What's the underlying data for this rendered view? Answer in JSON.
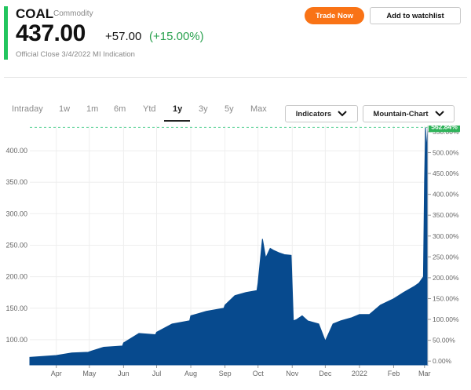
{
  "header": {
    "symbol": "COAL",
    "asset_type": "Commodity",
    "price": "437.00",
    "change": "+57.00",
    "change_pct": "(+15.00%)",
    "close_info": "Official Close 3/4/2022  MI Indication"
  },
  "actions": {
    "trade_label": "Trade Now",
    "watchlist_label": "Add to watchlist"
  },
  "timeframes": {
    "active": "1y",
    "items": [
      "Intraday",
      "1w",
      "1m",
      "6m",
      "Ytd",
      "1y",
      "3y",
      "5y",
      "Max"
    ]
  },
  "dropdowns": {
    "indicators_label": "Indicators",
    "chart_type_label": "Mountain-Chart",
    "chevron_icon": "chevron-down-icon"
  },
  "colors": {
    "accent_green": "#22c55e",
    "change_green": "#2aa14f",
    "trade_orange": "#f97316",
    "fill_blue": "#074a8e",
    "dashed_green": "#5fd39a",
    "badge_green": "#2fb35a"
  },
  "chart_data": {
    "type": "area",
    "title": "",
    "badge": "562.84%",
    "y_left_ticks": [
      "100.00",
      "150.00",
      "200.00",
      "250.00",
      "300.00",
      "350.00",
      "400.00"
    ],
    "y_right_ticks": [
      "0.00%",
      "50.00%",
      "100.00%",
      "150.00%",
      "200.00%",
      "250.00%",
      "300.00%",
      "350.00%",
      "400.00%",
      "450.00%",
      "500.00%",
      "550.00%"
    ],
    "x_labels": [
      "Apr",
      "May",
      "Jun",
      "Jul",
      "Aug",
      "Sep",
      "Oct",
      "Nov",
      "Dec",
      "2022",
      "Feb",
      "Mar"
    ],
    "ylim": [
      60,
      440
    ],
    "reference_value": 437,
    "series": [
      {
        "x": [
          "2021-03-08",
          "2021-04-01",
          "2021-04-15",
          "2021-04-30",
          "2021-05-03",
          "2021-05-14",
          "2021-05-31",
          "2021-06-01",
          "2021-06-15",
          "2021-06-30",
          "2021-07-01",
          "2021-07-15",
          "2021-07-31",
          "2021-08-01",
          "2021-08-15",
          "2021-08-31",
          "2021-09-01",
          "2021-09-10",
          "2021-09-20",
          "2021-09-30",
          "2021-10-01",
          "2021-10-05",
          "2021-10-08",
          "2021-10-12",
          "2021-10-15",
          "2021-10-20",
          "2021-10-25",
          "2021-10-31",
          "2021-11-02",
          "2021-11-05",
          "2021-11-10",
          "2021-11-15",
          "2021-11-25",
          "2021-12-01",
          "2021-12-08",
          "2021-12-15",
          "2021-12-25",
          "2022-01-01",
          "2022-01-10",
          "2022-01-20",
          "2022-02-01",
          "2022-02-10",
          "2022-02-20",
          "2022-02-24",
          "2022-02-28",
          "2022-03-01",
          "2022-03-02",
          "2022-03-03",
          "2022-03-04"
        ],
        "y": [
          72,
          75,
          79,
          80,
          82,
          88,
          90,
          95,
          110,
          108,
          112,
          125,
          130,
          138,
          145,
          150,
          155,
          170,
          175,
          178,
          190,
          260,
          230,
          245,
          242,
          238,
          235,
          234,
          130,
          132,
          138,
          130,
          125,
          98,
          125,
          130,
          135,
          140,
          140,
          155,
          165,
          175,
          185,
          190,
          200,
          350,
          437,
          400,
          437
        ]
      }
    ]
  }
}
